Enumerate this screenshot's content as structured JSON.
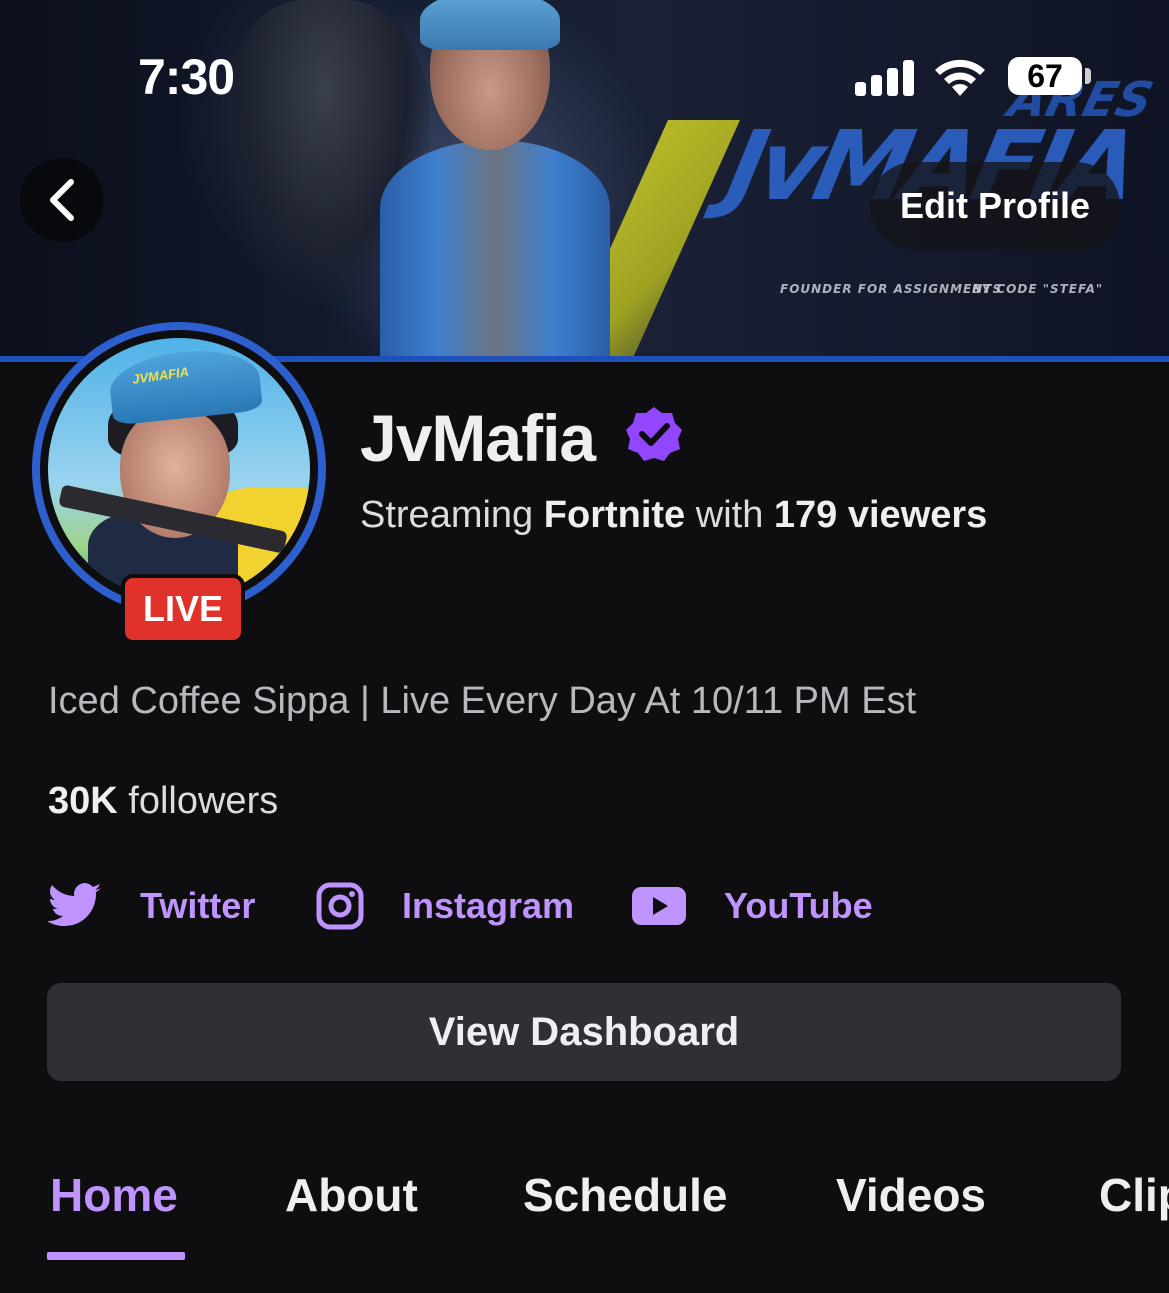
{
  "status_bar": {
    "time": "7:30",
    "battery": "67"
  },
  "header": {
    "edit_profile_label": "Edit Profile"
  },
  "banner": {
    "logo_text": "JvMAFIA",
    "logo_sub": "ARES",
    "credit_left": "FOUNDER FOR ASSIGNMENTS",
    "credit_right": "BY CODE \"STEFA\""
  },
  "avatar": {
    "hat_text": "JVMAFIA",
    "live_label": "LIVE",
    "ring_color": "#2d5fcf"
  },
  "profile": {
    "name": "JvMafia",
    "streaming_prefix": "Streaming",
    "game": "Fortnite",
    "with_text": "with",
    "viewers": "179 viewers",
    "bio": "Iced Coffee Sippa | Live Every Day At 10/11 PM Est",
    "followers_count": "30K",
    "followers_label": "followers"
  },
  "socials": [
    {
      "label": "Twitter",
      "icon": "twitter-bird-icon"
    },
    {
      "label": "Instagram",
      "icon": "instagram-icon"
    },
    {
      "label": "YouTube",
      "icon": "youtube-icon"
    }
  ],
  "dashboard_button": "View Dashboard",
  "tabs": [
    {
      "label": "Home",
      "active": true
    },
    {
      "label": "About"
    },
    {
      "label": "Schedule"
    },
    {
      "label": "Videos"
    },
    {
      "label": "Clips"
    }
  ],
  "colors": {
    "accent": "#bf94ff",
    "live": "#e0312b",
    "background": "#0e0e10",
    "verified": "#9147ff"
  }
}
